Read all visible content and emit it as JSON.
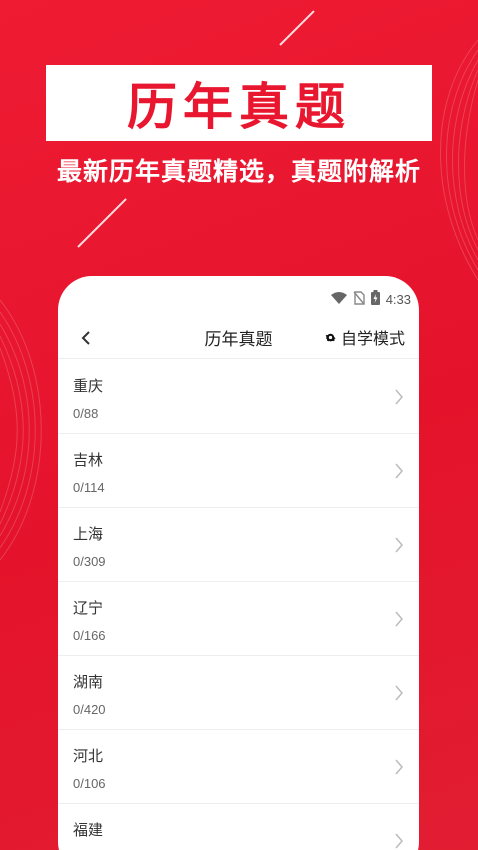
{
  "promo": {
    "title": "历年真题",
    "subtitle": "最新历年真题精选，真题附解析"
  },
  "statusbar": {
    "time": "4:33",
    "icons": [
      "wifi-icon",
      "no-sim-icon",
      "battery-icon"
    ]
  },
  "header": {
    "title": "历年真题",
    "mode_label": "自学模式",
    "back_icon": "chevron-left-icon",
    "mode_icon": "gear-icon"
  },
  "list": [
    {
      "name": "重庆",
      "progress": "0/88"
    },
    {
      "name": "吉林",
      "progress": "0/114"
    },
    {
      "name": "上海",
      "progress": "0/309"
    },
    {
      "name": "辽宁",
      "progress": "0/166"
    },
    {
      "name": "湖南",
      "progress": "0/420"
    },
    {
      "name": "河北",
      "progress": "0/106"
    },
    {
      "name": "福建",
      "progress": ""
    }
  ],
  "colors": {
    "brand_red": "#e8162e",
    "text_dark": "#222222",
    "text_muted": "#666666"
  }
}
